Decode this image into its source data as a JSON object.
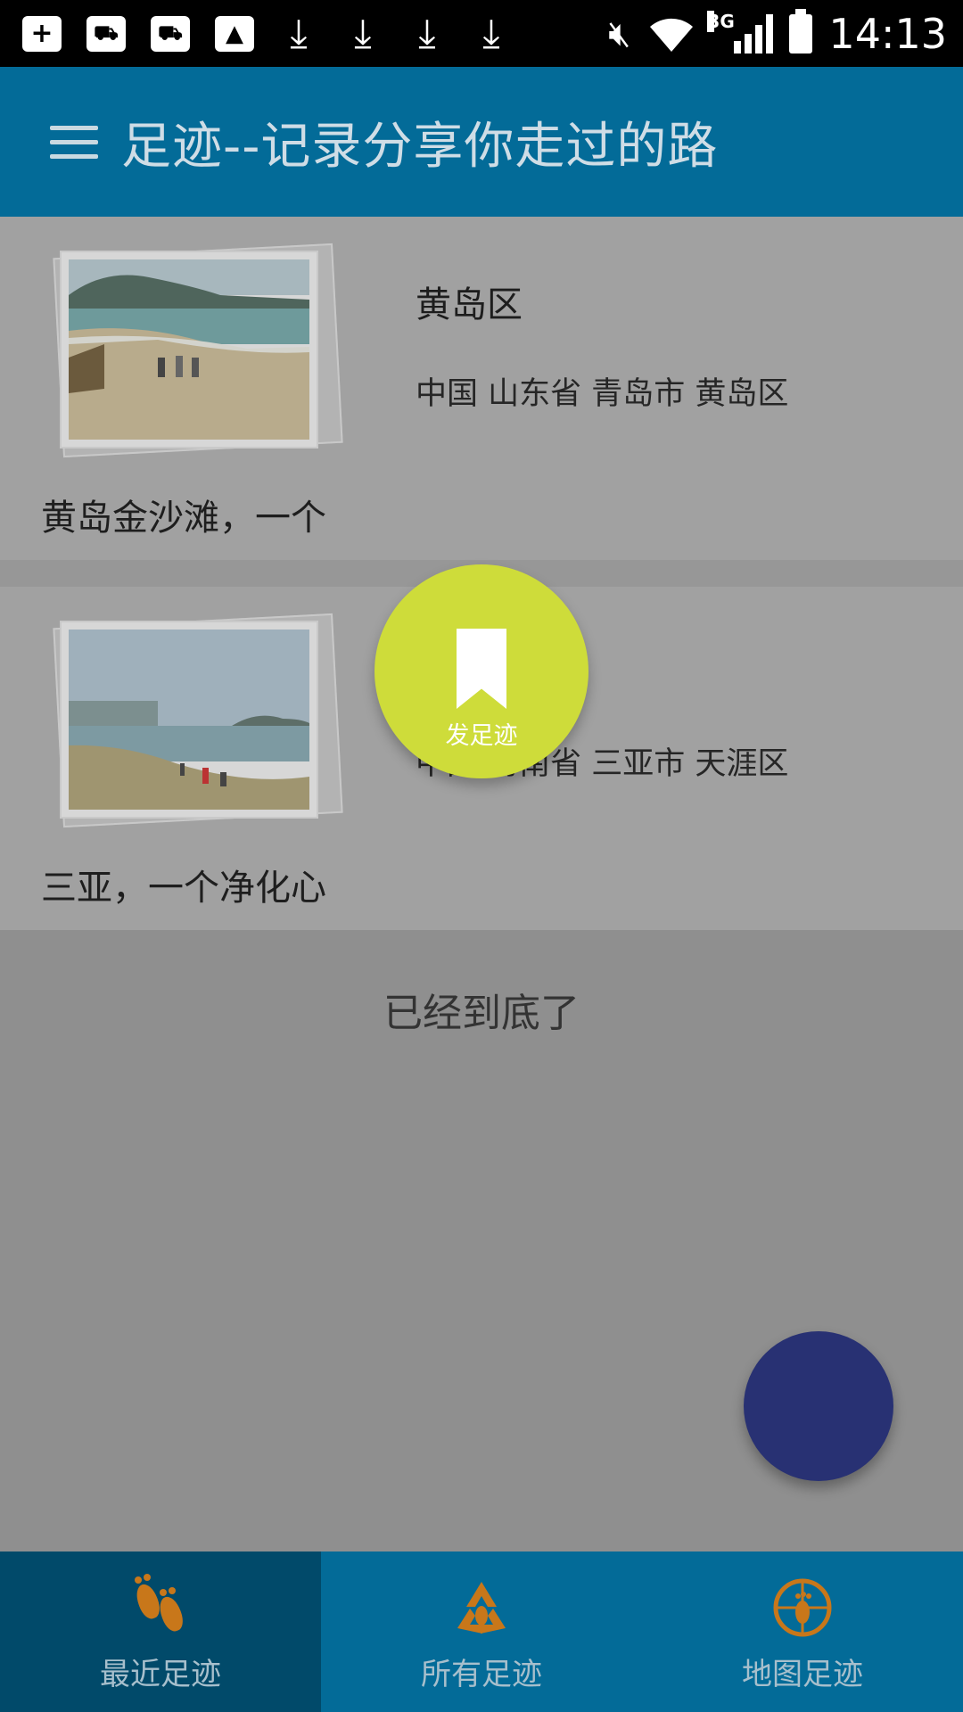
{
  "status_bar": {
    "time": "14:13",
    "network": "3G",
    "icons": [
      "add-icon",
      "mower-icon",
      "mower-icon",
      "image-icon",
      "download-icon",
      "download-icon",
      "download-icon",
      "download-icon",
      "mute-icon",
      "wifi-icon",
      "signal-icon",
      "battery-icon"
    ]
  },
  "app_bar": {
    "title": "足迹--记录分享你走过的路",
    "menu_icon": "menu-icon"
  },
  "list": {
    "items": [
      {
        "title": "黄岛区",
        "address": "中国 山东省 青岛市 黄岛区",
        "description": "黄岛金沙滩，一个"
      },
      {
        "title": "",
        "address": "中国 海南省 三亚市 天涯区",
        "description": "三亚，一个净化心"
      }
    ],
    "end_text": "已经到底了"
  },
  "fab": {
    "publish_label": "发足迹",
    "publish_color": "#cedc3a",
    "main_color": "#283173"
  },
  "bottom_nav": {
    "items": [
      {
        "label": "最近足迹",
        "icon": "footprints-icon",
        "active": true
      },
      {
        "label": "所有足迹",
        "icon": "recycle-footprint-icon",
        "active": false
      },
      {
        "label": "地图足迹",
        "icon": "map-footprint-icon",
        "active": false
      }
    ]
  },
  "colors": {
    "primary": "#036b98",
    "primary_dark": "#014a6a",
    "accent": "#cedc3a",
    "icon_orange": "#c8771a"
  }
}
